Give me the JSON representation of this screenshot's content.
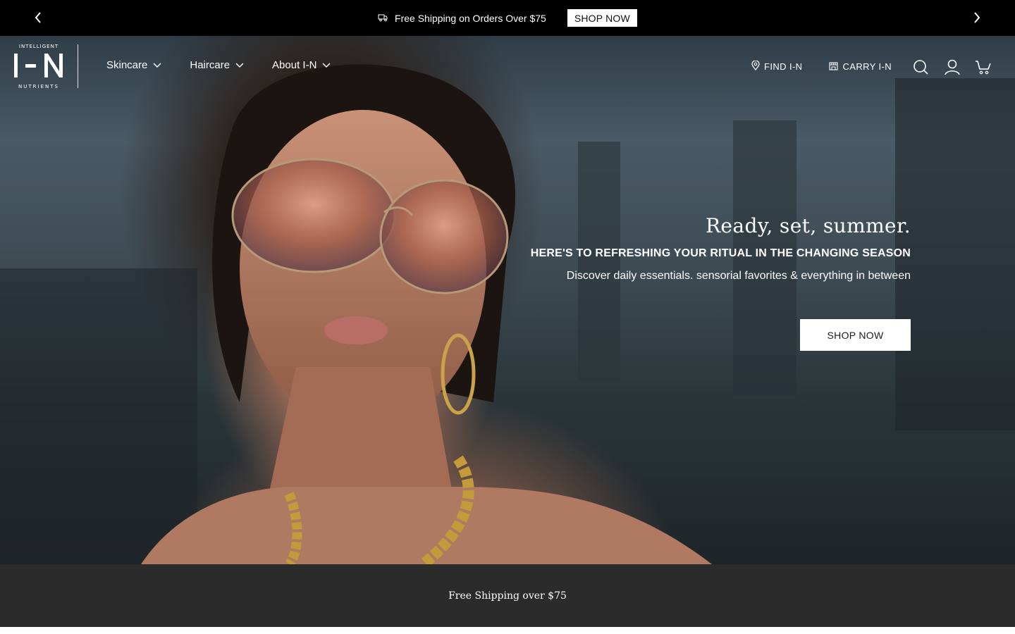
{
  "announcement": {
    "message": "Free Shipping on Orders Over $75",
    "button_label": "SHOP NOW",
    "icons": {
      "prev": "chevron-left-icon",
      "next": "chevron-right-icon",
      "truck": "truck-icon"
    }
  },
  "header": {
    "logo": {
      "top": "INTELLIGENT",
      "main": "I-N",
      "bottom": "NUTRIENTS"
    },
    "nav": [
      {
        "label": "Skincare"
      },
      {
        "label": "Haircare"
      },
      {
        "label": "About I-N"
      }
    ],
    "right_links": [
      {
        "label": "FIND I-N",
        "icon": "location-pin-icon"
      },
      {
        "label": "CARRY I-N",
        "icon": "store-icon"
      }
    ],
    "icons": [
      "search-icon",
      "account-icon",
      "cart-icon"
    ]
  },
  "hero": {
    "title": "Ready, set, summer.",
    "subtitle": "HERE'S TO REFRESHING YOUR RITUAL IN THE CHANGING SEASON",
    "description": "Discover daily essentials. sensorial favorites & everything in between",
    "cta_label": "SHOP NOW"
  },
  "band": {
    "text": "Free Shipping over $75"
  },
  "colors": {
    "announcement_bg": "#000000",
    "band_bg": "#2b2b2b",
    "text": "#ffffff"
  }
}
